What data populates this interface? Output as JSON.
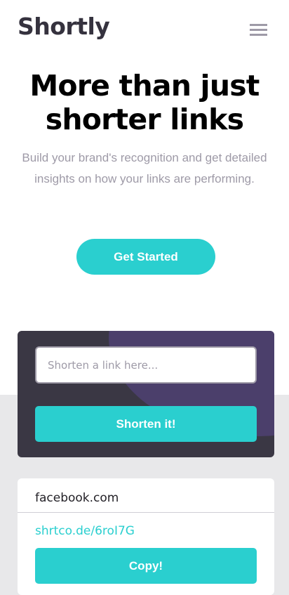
{
  "header": {
    "logo": "Shortly",
    "menu_icon": "hamburger-menu-icon"
  },
  "hero": {
    "title": "More than just shorter links",
    "subtitle": "Build your brand's recognition and get detailed insights on how your links are performing.",
    "cta_label": "Get Started"
  },
  "shorten": {
    "placeholder": "Shorten a link here...",
    "button_label": "Shorten it!"
  },
  "results": [
    {
      "original": "facebook.com",
      "short": "shrtco.de/6roI7G",
      "copy_label": "Copy!"
    }
  ],
  "colors": {
    "accent": "#2acfcf",
    "dark_violet": "#3a3744",
    "gray_text": "#9e9aa7",
    "logo_text": "#35323e"
  }
}
